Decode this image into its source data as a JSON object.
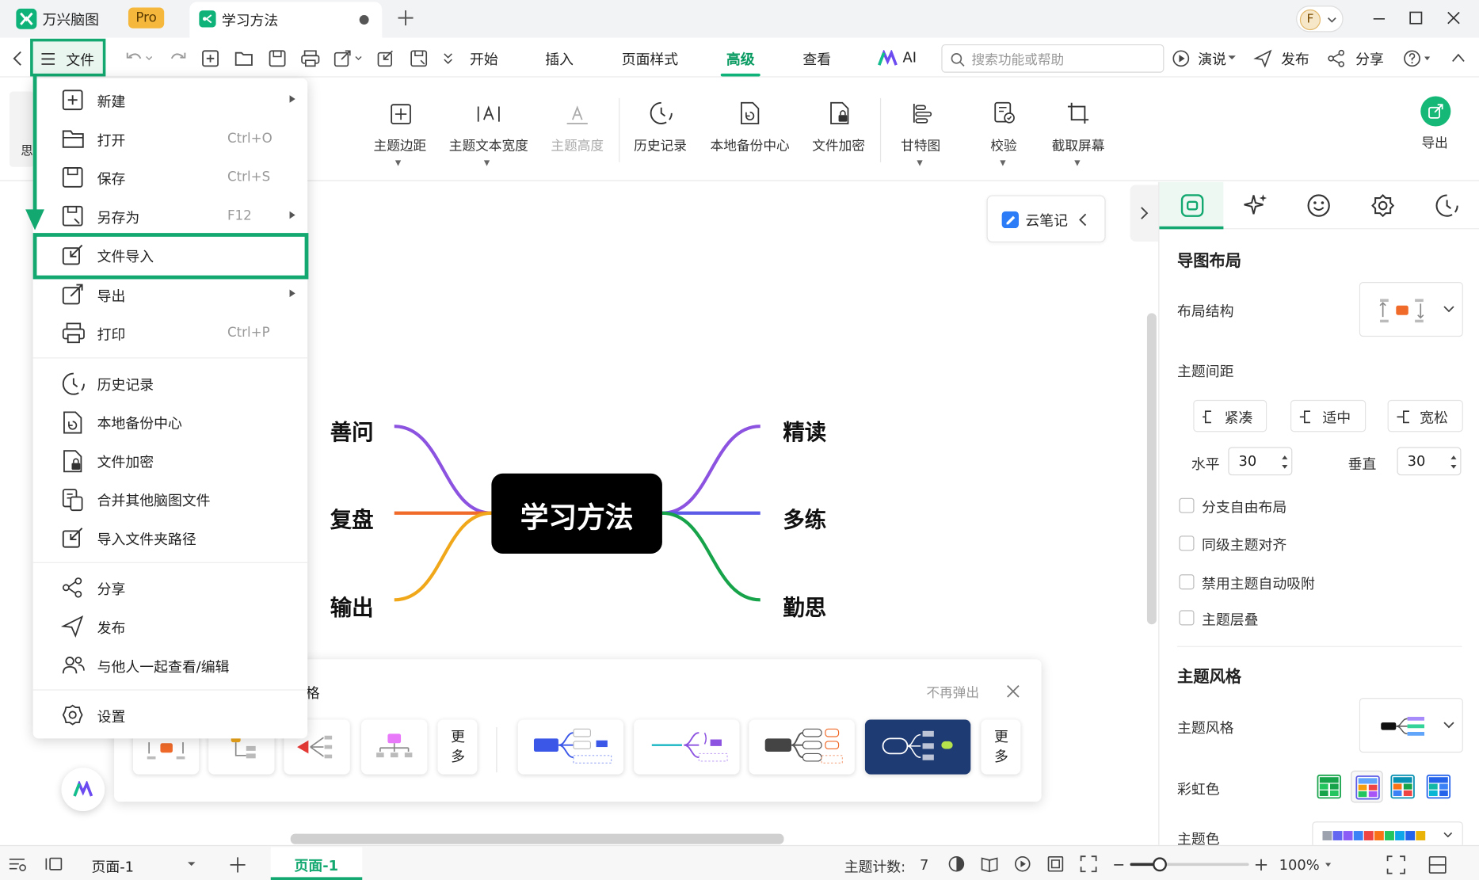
{
  "app": {
    "name": "万兴脑图",
    "badge": "Pro",
    "doc_tab": "学习方法"
  },
  "user": {
    "avatar_letter": "F"
  },
  "menubar": {
    "file_label": "文件",
    "tabs": [
      "开始",
      "插入",
      "页面样式",
      "高级",
      "查看"
    ],
    "active_tab": "高级",
    "ai_label": "AI",
    "search_placeholder": "搜索功能或帮助",
    "present_label": "演说",
    "publish_label": "发布",
    "share_label": "分享"
  },
  "ribbon": {
    "items": [
      "主题边距",
      "主题文本宽度",
      "主题高度",
      "历史记录",
      "本地备份中心",
      "文件加密",
      "甘特图",
      "校验",
      "截取屏幕"
    ],
    "export_label": "导出",
    "left_partial": "思"
  },
  "file_menu": {
    "items": [
      {
        "label": "新建",
        "shortcut": "",
        "submenu": true
      },
      {
        "label": "打开",
        "shortcut": "Ctrl+O",
        "submenu": false
      },
      {
        "label": "保存",
        "shortcut": "Ctrl+S",
        "submenu": false
      },
      {
        "label": "另存为",
        "shortcut": "F12",
        "submenu": true
      },
      {
        "label": "文件导入",
        "shortcut": "",
        "submenu": false
      },
      {
        "label": "导出",
        "shortcut": "",
        "submenu": true
      },
      {
        "label": "打印",
        "shortcut": "Ctrl+P",
        "submenu": false
      },
      {
        "label": "历史记录",
        "shortcut": "",
        "submenu": false
      },
      {
        "label": "本地备份中心",
        "shortcut": "",
        "submenu": false
      },
      {
        "label": "文件加密",
        "shortcut": "",
        "submenu": false
      },
      {
        "label": "合并其他脑图文件",
        "shortcut": "",
        "submenu": false
      },
      {
        "label": "导入文件夹路径",
        "shortcut": "",
        "submenu": false
      },
      {
        "label": "分享",
        "shortcut": "",
        "submenu": false
      },
      {
        "label": "发布",
        "shortcut": "",
        "submenu": false
      },
      {
        "label": "与他人一起查看/编辑",
        "shortcut": "",
        "submenu": false
      },
      {
        "label": "设置",
        "shortcut": "",
        "submenu": false
      }
    ],
    "highlighted": "文件导入"
  },
  "mindmap": {
    "central": "学习方法",
    "left": [
      "善问",
      "复盘",
      "输出"
    ],
    "right": [
      "精读",
      "多练",
      "勤思"
    ]
  },
  "cloud_note": {
    "label": "云笔记"
  },
  "style_popup": {
    "title_partial": "格",
    "dismiss": "不再弹出",
    "more": "更多"
  },
  "right_panel": {
    "layout_title": "导图布局",
    "layout_structure_label": "布局结构",
    "spacing_label": "主题间距",
    "spacing_options": [
      "紧凑",
      "适中",
      "宽松"
    ],
    "horizontal_label": "水平",
    "horizontal_value": "30",
    "vertical_label": "垂直",
    "vertical_value": "30",
    "checkboxes": [
      "分支自由布局",
      "同级主题对齐",
      "禁用主题自动吸附",
      "主题层叠"
    ],
    "style_title": "主题风格",
    "style_label": "主题风格",
    "rainbow_label": "彩虹色",
    "theme_color_label": "主题色"
  },
  "statusbar": {
    "page_select": "页面-1",
    "page_tab": "页面-1",
    "topic_count_label": "主题计数:",
    "topic_count": "7",
    "zoom": "100%"
  },
  "colors": {
    "accent_green": "#00a86b",
    "highlight_box": "#12a870",
    "branch_purple": "#8c52e0",
    "branch_orange": "#f06a2a",
    "branch_yellow": "#f0a81a",
    "branch_blue": "#5b5be8",
    "branch_green": "#16a34a"
  }
}
